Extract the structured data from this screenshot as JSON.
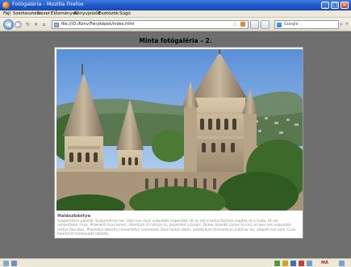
{
  "window": {
    "title": "Fotógaléria - Mozilla Firefox",
    "controls": {
      "minimize": "_",
      "maximize": "□",
      "close": "×"
    }
  },
  "menubar": {
    "items": [
      "Fájl",
      "Szerkesztés",
      "Nézet",
      "Előzmények",
      "Könyvjelzők",
      "Eszközök",
      "Súgó"
    ]
  },
  "navbar": {
    "back_glyph": "◀",
    "forward_glyph": "▶",
    "reload_glyph": "↻",
    "stop_glyph": "✕",
    "home_glyph": "⌂",
    "url": "file:///D:/Konv/Fényképek/index.html",
    "bookmark_star": "☆",
    "search_placeholder": "Google",
    "search_go": "⌕",
    "menu_arrow": "»"
  },
  "page": {
    "title": "Minta fotógaléria – 2.",
    "caption_title": "Halászbástya",
    "caption_text": "Suspendisse potenti. Suspendisse nec nibh non risus vulputate imperdiet. Ut ac est a tellus facilisis sagittis et a nulla. Ut vel consectetur risus. Praesent risus lorem, interdum id rutrum in, imperdiet a turpis. Donec blandit varius mi orci ornare nec vulputate metus faucibus. Phasellus lobortis consectetur commodo. Duis luctus diam, vestibulum fermentum pulvinar eu, aliquet non sem. Cras hendrerit malesuada lobortis."
  },
  "statusbar": {
    "right_text": "MÁ"
  },
  "colors": {
    "titlebar": "#1f55c8",
    "background": "#6e6e6e",
    "card": "#ffffff"
  }
}
